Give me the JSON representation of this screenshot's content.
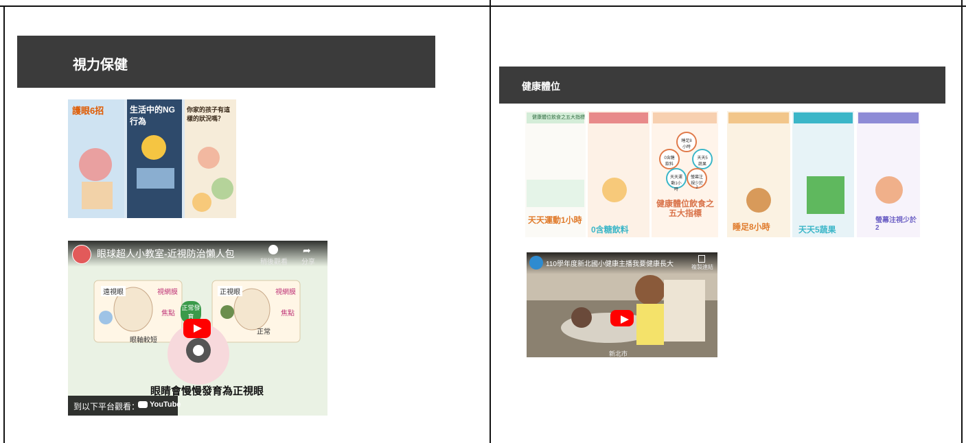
{
  "left_section": {
    "header": "視力保健",
    "poster": {
      "panel1_title": "護眼6招",
      "panel2_title": "生活中的NG行為",
      "panel3_title": "你家的孩子有這樣的狀況嗎？"
    },
    "video": {
      "title": "眼球超人小教室-近視防治懶人包",
      "watch_later": "稍後觀看",
      "share": "分享",
      "label_hyperopia": "遠視眼",
      "label_retina_1": "視網膜",
      "label_focus_1": "焦點",
      "label_axis_short": "眼軸較短",
      "label_normal_bubble": "正常發育",
      "label_emmetropia": "正視眼",
      "label_retina_2": "視網膜",
      "label_focus_2": "焦點",
      "label_normal": "正常",
      "caption": "眼睛會慢慢發育為正視眼",
      "watch_on": "到以下平台觀看：",
      "youtube": "YouTube"
    }
  },
  "right_section": {
    "header": "健康體位",
    "poster": {
      "title_top": "健康體位飲食之五大指標",
      "big_title": "健康體位飲食之五大指標",
      "item_exercise": "天天運動1小時",
      "item_drink": "0含糖飲料",
      "item_sleep": "睡足8小時",
      "item_veg": "天天5蔬果",
      "item_screen": "螢幕注視少於2",
      "circle_1": "睡足8小時",
      "circle_2": "天天5蔬果",
      "circle_3": "0含糖飲料",
      "circle_4": "天天運動1小時",
      "circle_5": "螢幕注視少於2"
    },
    "video": {
      "title": "110學年度新北國小健康主播我要健康長大",
      "copy_link": "複製連結",
      "bottom_text": "新北市"
    }
  },
  "colors": {
    "header_bg": "#3b3b3b",
    "header_text": "#ffffff",
    "youtube_red": "#ff0000"
  }
}
